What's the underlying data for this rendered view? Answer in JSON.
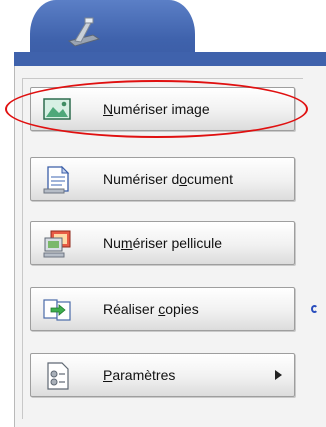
{
  "window": {
    "active_tab_icon": "scanner-icon"
  },
  "menu": {
    "items": [
      {
        "icon": "image-icon",
        "before": "",
        "accel": "N",
        "after": "umériser image",
        "has_arrow": false
      },
      {
        "icon": "document-icon",
        "before": "Numériser d",
        "accel": "o",
        "after": "cument",
        "has_arrow": false
      },
      {
        "icon": "film-icon",
        "before": "Nu",
        "accel": "m",
        "after": "ériser pellicule",
        "has_arrow": false
      },
      {
        "icon": "copy-icon",
        "before": "Réaliser ",
        "accel": "c",
        "after": "opies",
        "has_arrow": false
      },
      {
        "icon": "settings-icon",
        "before": "",
        "accel": "P",
        "after": "aramètres",
        "has_arrow": true
      }
    ]
  },
  "highlight": {
    "color": "#e01010",
    "target": "scan-image-button"
  },
  "colors": {
    "accent": "#3f62ac"
  }
}
